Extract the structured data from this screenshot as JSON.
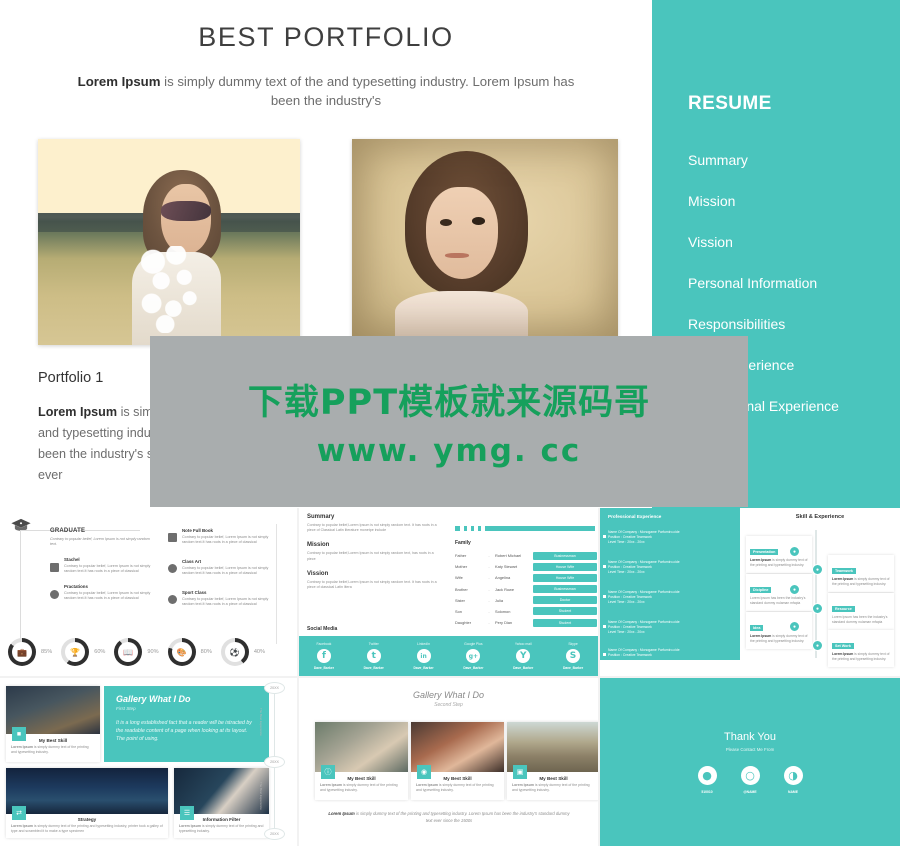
{
  "hero": {
    "title": "BEST PORTFOLIO",
    "subtitle_lead": "Lorem Ipsum",
    "subtitle_rest": " is simply dummy text of the  and typesetting industry. Lorem Ipsum has been the industry's",
    "portfolio_title": "Portfolio 1",
    "portfolio_lead": "Lorem Ipsum",
    "portfolio_body": " is simply dummy text of the  and typesetting industry. Lorem Ipsum has been the industry's standard dummy text ever",
    "photo_1_alt": "woman-in-sunlit-field-photo",
    "photo_2_alt": "child-portrait-photo"
  },
  "resume": {
    "heading": "RESUME",
    "accent": "#4ac5bd",
    "items": [
      {
        "label": "Summary"
      },
      {
        "label": "Mission"
      },
      {
        "label": "Vission"
      },
      {
        "label": "Personal Information"
      },
      {
        "label": "Responsibilities"
      },
      {
        "label": "Work Experience"
      },
      {
        "label": "Professional Experience"
      }
    ]
  },
  "watermark": {
    "chinese": "下载PPT模板就来源码哥",
    "url": "www. ymg. cc",
    "text_color": "#16a05c",
    "panel_color": "#a9adae"
  },
  "thumbs": {
    "graduate": {
      "heading": "GRADUATE",
      "intro": "Contrary to popular belief, Lorem Ipsum is not simply random text.",
      "items": [
        {
          "title": "Stachel",
          "text": "Contrary to popular belief, Lorem Ipsum is not simply random text.It has roots in a piece of classical",
          "icon": "briefcase-icon"
        },
        {
          "title": "Practations",
          "text": "Contrary to popular belief, Lorem Ipsum is not simply random text.It has roots in a piece of classical",
          "icon": "trophy-icon"
        },
        {
          "title": "Note Full Book",
          "text": "Contrary to popular belief, Lorem Ipsum is not simply random text.It has roots in a piece of classical",
          "icon": "book-icon"
        },
        {
          "title": "Class Art",
          "text": "Contrary to popular belief, Lorem Ipsum is not simply random text.It has roots in a piece of classical",
          "icon": "palette-icon"
        },
        {
          "title": "Sport Class",
          "text": "Contrary to popular belief, Lorem Ipsum is not simply random text.It has roots in a piece of classical",
          "icon": "ball-icon"
        }
      ],
      "rings": [
        {
          "icon": "briefcase-icon",
          "pct": "85%"
        },
        {
          "icon": "trophy-icon",
          "pct": "60%"
        },
        {
          "icon": "book-icon",
          "pct": "90%"
        },
        {
          "icon": "palette-icon",
          "pct": "80%"
        },
        {
          "icon": "ball-icon",
          "pct": "40%"
        }
      ]
    },
    "summary": {
      "sections": [
        {
          "title": "Summary",
          "text": "Contrary to popular belief,Lorem Ipsum is not simply random text. It has roots in a piece of Classical Latin literature monetpe include"
        },
        {
          "title": "Mission",
          "text": "Contrary to popular belief,Lorem Ipsum is not simply random text, has roots in a piece"
        },
        {
          "title": "Vission",
          "text": "Contrary to popular belief,Lorem Ipsum is not simply random text. It has roots in a piece of classical Latin litera"
        }
      ],
      "social_label": "Social Media",
      "family_heading": "Family",
      "family": [
        {
          "role": "Father",
          "name": "Robert Michael",
          "tag": "Businessman"
        },
        {
          "role": "Mother",
          "name": "Katy Stewart",
          "tag": "House Wife"
        },
        {
          "role": "Wife",
          "name": "Angelina",
          "tag": "House Wife"
        },
        {
          "role": "Brother",
          "name": "Jack Rowe",
          "tag": "Businessman"
        },
        {
          "role": "Sister",
          "name": "Julia",
          "tag": "Doctor"
        },
        {
          "role": "Son",
          "name": "Solomon",
          "tag": "Student"
        },
        {
          "role": "Daughter",
          "name": "Pery Dian",
          "tag": "Student"
        }
      ],
      "socials": [
        {
          "network": "Facebook",
          "glyph": "f",
          "handle": "Dave_Barker",
          "icon": "facebook-icon"
        },
        {
          "network": "Twitter",
          "glyph": "t",
          "handle": "Dave_Barker",
          "icon": "twitter-icon"
        },
        {
          "network": "LinkedIn",
          "glyph": "in",
          "handle": "Dave_Barker",
          "icon": "linkedin-icon"
        },
        {
          "network": "Google Plus",
          "glyph": "g+",
          "handle": "Dave_Barker",
          "icon": "googleplus-icon"
        },
        {
          "network": "Yahoo mail",
          "glyph": "Y",
          "handle": "Dave_Barker",
          "icon": "yahoo-icon"
        },
        {
          "network": "Skype",
          "glyph": "S",
          "handle": "Dave_Barker",
          "icon": "skype-icon"
        }
      ]
    },
    "professional": {
      "panel_heading": "Professional Experience",
      "entries": [
        {
          "l1": "Name Of Company",
          "l2": "Position",
          "l3": "Level Time",
          "v1": "Monogame Parfumiro.cide",
          "v2": "Creative Teamwork",
          "v3": "20xx - 20xx"
        },
        {
          "l1": "Name Of Company",
          "l2": "Position",
          "l3": "Level Time",
          "v1": "Monogame Parfumiro.cide",
          "v2": "Creative Teamwork",
          "v3": "20xx - 20xx"
        },
        {
          "l1": "Name Of Company",
          "l2": "Position",
          "l3": "Level Time",
          "v1": "Monogame Parfumiro.cide",
          "v2": "Creative Teamwork",
          "v3": "20xx - 20xx"
        },
        {
          "l1": "Name Of Company",
          "l2": "Position",
          "l3": "Level Time",
          "v1": "Monogame Parfumiro.cide",
          "v2": "Creative Teamwork",
          "v3": "20xx - 20xx"
        },
        {
          "l1": "Name Of Company",
          "l2": "Position",
          "l3": "Level Time",
          "v1": "Monogame Parfumiro.cide",
          "v2": "Creative Teamwork",
          "v3": "20xx - 20xx"
        }
      ],
      "skill_heading": "Skill & Experience",
      "left_cards": [
        {
          "tag": "Presentation",
          "lead": "Lorem Ipsum",
          "text": " is simply dummy text of the printing and typesetting industry."
        },
        {
          "tag": "Dicipline",
          "lead": "",
          "text": "Lorem Ipsum has been the industry's standard dummy nulaman mfapia"
        },
        {
          "tag": "Idea",
          "lead": "Lorem Ipsum",
          "text": " is simply dummy text of the printing and typesetting industry."
        }
      ],
      "right_cards": [
        {
          "tag": "Teamwork",
          "lead": "Lorem Ipsum",
          "text": " is simply dummy text of the printing and typesetting industry."
        },
        {
          "tag": "Resource",
          "lead": "",
          "text": "Lorem Ipsum has been the industry's standard dummy nulaman mfapia"
        },
        {
          "tag": "Set Work",
          "lead": "Lorem Ipsum",
          "text": " is simply dummy text of the printing and typesetting industry."
        }
      ]
    },
    "gallery1": {
      "heading": "Gallery What I Do",
      "sub": "First  Step",
      "body": "It is a long established fact that a reader  will be istracted by the readable  content  of a page when looking  at its  layout.  The  point  of using.",
      "cards": [
        {
          "title": "My Best Skill",
          "lead": "Lorem Ipsum",
          "text": " is simply dummy text of the printing and typesetting industry.",
          "icon": "video-icon",
          "image": "gamer-controller-photo"
        },
        {
          "title": "Strategy",
          "lead": "Lorem Ipsum",
          "text": " is simply dummy text of the printing and typesetting industry, printer took a galley of type and scrambled it to make a type specimen",
          "icon": "refresh-icon",
          "image": "tokyo-night-city-photo"
        },
        {
          "title": "Information  Filter",
          "lead": "Lorem Ipsum",
          "text": " is simply dummy text of the printing and typesetting industry.",
          "icon": "filter-icon",
          "image": "dancer-photo"
        }
      ],
      "years": [
        "20XX",
        "20XX",
        "20XX"
      ],
      "rail_label": "The Best Experience"
    },
    "gallery2": {
      "heading": "Gallery What I Do",
      "sub": "Second  Step",
      "cards": [
        {
          "title": "My Best Skill",
          "lead": "Lorem Ipsum",
          "text": " is simply dummy text of the printing and typesetting industry.",
          "icon": "info-icon",
          "image": "girl-holding-plant-photo"
        },
        {
          "title": "My Best Skill",
          "lead": "Lorem Ipsum",
          "text": " is simply dummy text of the printing and typesetting industry.",
          "icon": "camera-icon",
          "image": "redhead-portrait-photo"
        },
        {
          "title": "My Best Skill",
          "lead": "Lorem Ipsum",
          "text": " is simply dummy text of the printing and typesetting industry.",
          "icon": "image-icon",
          "image": "wooden-bridge-photo"
        }
      ],
      "footer_lead": "Lorem Ipsum",
      "footer_text": " is simply dummy text of the printing and typesetting industry. Lorem Ipsum has been the industry's standard dummy text ever since the 1500s"
    },
    "thankyou": {
      "heading": "Thank You",
      "sub": "Please Contact Me From",
      "contacts": [
        {
          "label": "510010",
          "icon": "qq-icon",
          "glyph": "●"
        },
        {
          "label": "@NAME",
          "icon": "weibo-icon",
          "glyph": "○"
        },
        {
          "label": "NAME",
          "icon": "wechat-icon",
          "glyph": "◑"
        }
      ]
    }
  }
}
